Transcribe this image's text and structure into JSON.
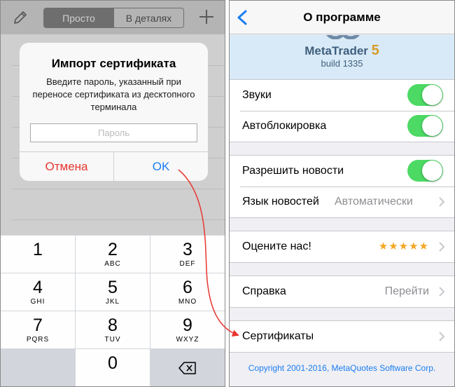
{
  "left": {
    "segments": [
      "Просто",
      "В деталях"
    ],
    "dialog": {
      "title": "Импорт сертификата",
      "message": "Введите пароль, указанный при переносе сертификата из десктопного терминала",
      "placeholder": "Пароль",
      "cancel": "Отмена",
      "ok": "OK"
    },
    "keypad": [
      {
        "digit": "1",
        "letters": ""
      },
      {
        "digit": "2",
        "letters": "ABC"
      },
      {
        "digit": "3",
        "letters": "DEF"
      },
      {
        "digit": "4",
        "letters": "GHI"
      },
      {
        "digit": "5",
        "letters": "JKL"
      },
      {
        "digit": "6",
        "letters": "MNO"
      },
      {
        "digit": "7",
        "letters": "PQRS"
      },
      {
        "digit": "8",
        "letters": "TUV"
      },
      {
        "digit": "9",
        "letters": "WXYZ"
      },
      {
        "digit": "0",
        "letters": ""
      }
    ]
  },
  "right": {
    "nav_title": "О программе",
    "brand": "MetaTrader",
    "brand_number": "5",
    "build": "build 1335",
    "rows": {
      "sounds": "Звуки",
      "autolock": "Автоблокировка",
      "allow_news": "Разрешить новости",
      "news_language": "Язык новостей",
      "news_language_value": "Автоматически",
      "rate_us": "Оцените нас!",
      "rate_stars": "★★★★★",
      "help": "Справка",
      "help_value": "Перейти",
      "certificates": "Сертификаты"
    },
    "copyright": "Copyright 2001-2016, MetaQuotes Software Corp."
  },
  "colors": {
    "accent_blue": "#1a7df2",
    "toggle_green": "#4cd964",
    "cancel_red": "#e8352f",
    "star_orange": "#f5a623",
    "annotation_arrow": "#e8352f"
  }
}
